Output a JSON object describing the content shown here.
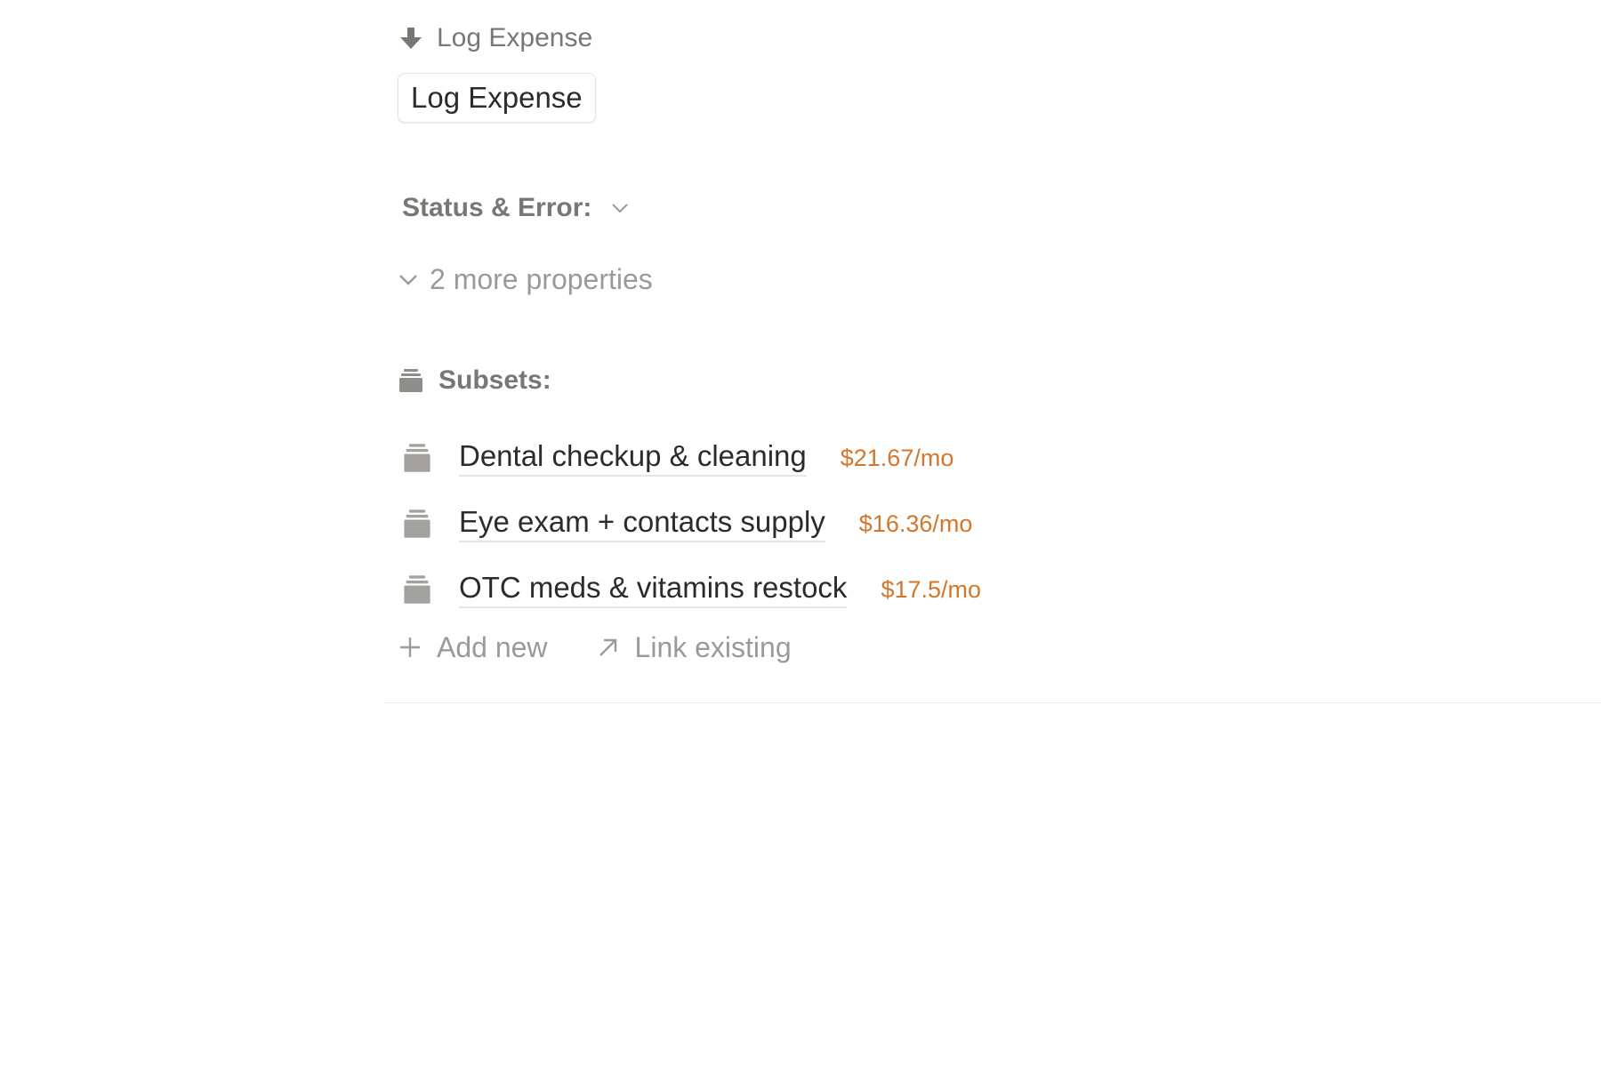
{
  "log_expense": {
    "property_label": "Log Expense",
    "button_label": "Log Expense",
    "icon": "arrow-down-icon"
  },
  "status": {
    "label": "Status & Error:",
    "icon": "chevron-down-icon"
  },
  "more_properties": {
    "label": "2 more properties",
    "icon": "chevron-down-icon"
  },
  "subsets": {
    "label": "Subsets:",
    "icon": "stack-icon",
    "items": [
      {
        "name": "Dental checkup & cleaning",
        "amount": "$21.67/mo"
      },
      {
        "name": "Eye exam + contacts supply",
        "amount": "$16.36/mo"
      },
      {
        "name": "OTC meds & vitamins restock",
        "amount": "$17.5/mo"
      }
    ]
  },
  "actions": {
    "add_new": "Add new",
    "link_existing": "Link existing"
  },
  "colors": {
    "amount": "#d4762c",
    "muted_text": "#787774",
    "light_text": "#9b9a97",
    "primary_text": "#2b2b2b"
  }
}
